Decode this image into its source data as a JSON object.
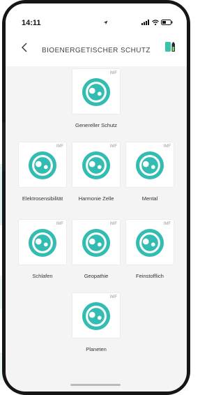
{
  "status_bar": {
    "time": "14:11"
  },
  "header": {
    "title": "BIOENERGETISCHER SCHUTZ"
  },
  "tiles": [
    {
      "label": "Genereller Schutz",
      "badge": "IMF"
    },
    {
      "label": "Elektrosensibilität",
      "badge": "IMF"
    },
    {
      "label": "Harmonie Zelle",
      "badge": "IMF"
    },
    {
      "label": "Mental",
      "badge": "IMF"
    },
    {
      "label": "Schlafen",
      "badge": "IMF"
    },
    {
      "label": "Geopathie",
      "badge": "IMF"
    },
    {
      "label": "Feinstofflich",
      "badge": "IMF"
    },
    {
      "label": "Planeten",
      "badge": "IMF"
    }
  ],
  "colors": {
    "accent": "#33bdb2",
    "background": "#f4f4f5"
  },
  "icons": {
    "tile": "cell-balance-icon",
    "back": "chevron-left-icon",
    "header_action": "phone-battery-icon"
  }
}
